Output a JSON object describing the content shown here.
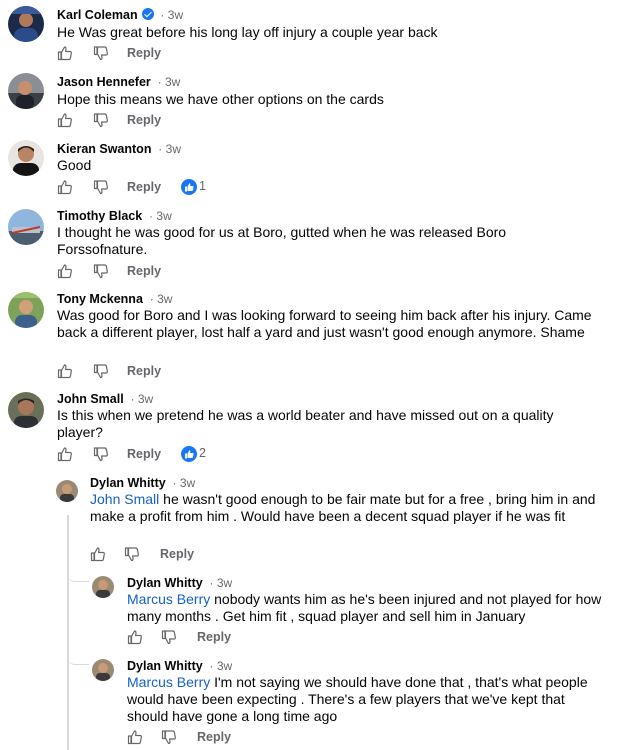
{
  "comments": [
    {
      "name": "Karl Coleman",
      "verified": true,
      "time": "3w",
      "text": "He Was great before his long lay off injury a couple year back",
      "like_label": "like-icon",
      "reply": "Reply"
    },
    {
      "name": "Jason Hennefer",
      "time": "3w",
      "text": "Hope this means we have other options on the cards",
      "reply": "Reply"
    },
    {
      "name": "Kieran Swanton",
      "time": "3w",
      "text": "Good",
      "reply": "Reply",
      "reactions": "1"
    },
    {
      "name": "Timothy Black",
      "time": "3w",
      "text": "I thought he was good for us at Boro, gutted when he was released Boro Forssofnature.",
      "reply": "Reply"
    },
    {
      "name": "Tony Mckenna",
      "time": "3w",
      "text": "Was good for Boro and I was looking forward to seeing him back after his injury. Came back a different player, lost half a yard and just wasn't good enough anymore. Shame",
      "reply": "Reply"
    },
    {
      "name": "John Small",
      "time": "3w",
      "text": "Is this when we pretend he was a world beater and have missed out on a quality player?",
      "reply": "Reply",
      "reactions": "2"
    }
  ],
  "replies": [
    {
      "name": "Dylan Whitty",
      "time": "3w",
      "mention": "John Small",
      "text": " he wasn't good enough to be fair mate but for a free , bring him in and make a profit from him . Would have been a decent squad player if he was fit",
      "reply": "Reply"
    },
    {
      "name": "Dylan Whitty",
      "time": "3w",
      "mention": "Marcus Berry",
      "text": " nobody wants him as he's been injured and not played for how many months . Get him fit , squad player and sell him in January",
      "reply": "Reply"
    },
    {
      "name": "Dylan Whitty",
      "time": "3w",
      "mention": "Marcus Berry",
      "text": " I'm not saying we should have done that , that's what people would have been expecting . There's a few players that we've kept that should have gone a long time ago",
      "reply": "Reply"
    }
  ],
  "separator": "·",
  "colors": {
    "accent": "#1877f2",
    "mention": "#1560c7",
    "muted": "#65676b"
  }
}
